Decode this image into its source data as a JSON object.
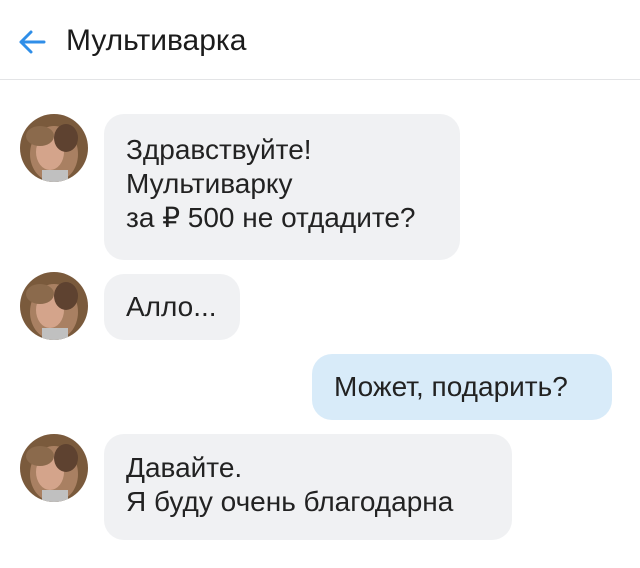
{
  "header": {
    "title": "Мультиварка",
    "back_icon": "arrow-left-icon",
    "accent_color": "#2f8ee8"
  },
  "messages": [
    {
      "direction": "incoming",
      "lines": [
        "Здравствуйте!",
        "Мультиварку",
        "за ₽ 500 не отдадите?"
      ]
    },
    {
      "direction": "incoming",
      "lines": [
        "Алло..."
      ]
    },
    {
      "direction": "outgoing",
      "lines": [
        "Может, подарить?"
      ]
    },
    {
      "direction": "incoming",
      "lines": [
        "Давайте.",
        "Я буду очень благодарна"
      ]
    }
  ],
  "colors": {
    "incoming_bubble": "#f0f1f3",
    "outgoing_bubble": "#d8ebf9",
    "text": "#222222"
  }
}
